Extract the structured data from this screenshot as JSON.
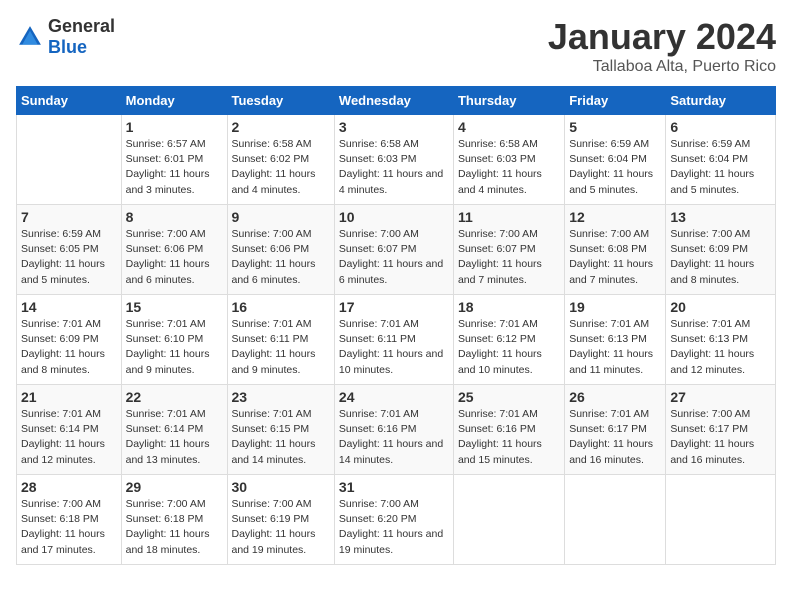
{
  "header": {
    "logo_general": "General",
    "logo_blue": "Blue",
    "month_title": "January 2024",
    "subtitle": "Tallaboa Alta, Puerto Rico"
  },
  "days_of_week": [
    "Sunday",
    "Monday",
    "Tuesday",
    "Wednesday",
    "Thursday",
    "Friday",
    "Saturday"
  ],
  "weeks": [
    [
      {
        "date": "",
        "sunrise": "",
        "sunset": "",
        "daylight": ""
      },
      {
        "date": "1",
        "sunrise": "Sunrise: 6:57 AM",
        "sunset": "Sunset: 6:01 PM",
        "daylight": "Daylight: 11 hours and 3 minutes."
      },
      {
        "date": "2",
        "sunrise": "Sunrise: 6:58 AM",
        "sunset": "Sunset: 6:02 PM",
        "daylight": "Daylight: 11 hours and 4 minutes."
      },
      {
        "date": "3",
        "sunrise": "Sunrise: 6:58 AM",
        "sunset": "Sunset: 6:03 PM",
        "daylight": "Daylight: 11 hours and 4 minutes."
      },
      {
        "date": "4",
        "sunrise": "Sunrise: 6:58 AM",
        "sunset": "Sunset: 6:03 PM",
        "daylight": "Daylight: 11 hours and 4 minutes."
      },
      {
        "date": "5",
        "sunrise": "Sunrise: 6:59 AM",
        "sunset": "Sunset: 6:04 PM",
        "daylight": "Daylight: 11 hours and 5 minutes."
      },
      {
        "date": "6",
        "sunrise": "Sunrise: 6:59 AM",
        "sunset": "Sunset: 6:04 PM",
        "daylight": "Daylight: 11 hours and 5 minutes."
      }
    ],
    [
      {
        "date": "7",
        "sunrise": "Sunrise: 6:59 AM",
        "sunset": "Sunset: 6:05 PM",
        "daylight": "Daylight: 11 hours and 5 minutes."
      },
      {
        "date": "8",
        "sunrise": "Sunrise: 7:00 AM",
        "sunset": "Sunset: 6:06 PM",
        "daylight": "Daylight: 11 hours and 6 minutes."
      },
      {
        "date": "9",
        "sunrise": "Sunrise: 7:00 AM",
        "sunset": "Sunset: 6:06 PM",
        "daylight": "Daylight: 11 hours and 6 minutes."
      },
      {
        "date": "10",
        "sunrise": "Sunrise: 7:00 AM",
        "sunset": "Sunset: 6:07 PM",
        "daylight": "Daylight: 11 hours and 6 minutes."
      },
      {
        "date": "11",
        "sunrise": "Sunrise: 7:00 AM",
        "sunset": "Sunset: 6:07 PM",
        "daylight": "Daylight: 11 hours and 7 minutes."
      },
      {
        "date": "12",
        "sunrise": "Sunrise: 7:00 AM",
        "sunset": "Sunset: 6:08 PM",
        "daylight": "Daylight: 11 hours and 7 minutes."
      },
      {
        "date": "13",
        "sunrise": "Sunrise: 7:00 AM",
        "sunset": "Sunset: 6:09 PM",
        "daylight": "Daylight: 11 hours and 8 minutes."
      }
    ],
    [
      {
        "date": "14",
        "sunrise": "Sunrise: 7:01 AM",
        "sunset": "Sunset: 6:09 PM",
        "daylight": "Daylight: 11 hours and 8 minutes."
      },
      {
        "date": "15",
        "sunrise": "Sunrise: 7:01 AM",
        "sunset": "Sunset: 6:10 PM",
        "daylight": "Daylight: 11 hours and 9 minutes."
      },
      {
        "date": "16",
        "sunrise": "Sunrise: 7:01 AM",
        "sunset": "Sunset: 6:11 PM",
        "daylight": "Daylight: 11 hours and 9 minutes."
      },
      {
        "date": "17",
        "sunrise": "Sunrise: 7:01 AM",
        "sunset": "Sunset: 6:11 PM",
        "daylight": "Daylight: 11 hours and 10 minutes."
      },
      {
        "date": "18",
        "sunrise": "Sunrise: 7:01 AM",
        "sunset": "Sunset: 6:12 PM",
        "daylight": "Daylight: 11 hours and 10 minutes."
      },
      {
        "date": "19",
        "sunrise": "Sunrise: 7:01 AM",
        "sunset": "Sunset: 6:13 PM",
        "daylight": "Daylight: 11 hours and 11 minutes."
      },
      {
        "date": "20",
        "sunrise": "Sunrise: 7:01 AM",
        "sunset": "Sunset: 6:13 PM",
        "daylight": "Daylight: 11 hours and 12 minutes."
      }
    ],
    [
      {
        "date": "21",
        "sunrise": "Sunrise: 7:01 AM",
        "sunset": "Sunset: 6:14 PM",
        "daylight": "Daylight: 11 hours and 12 minutes."
      },
      {
        "date": "22",
        "sunrise": "Sunrise: 7:01 AM",
        "sunset": "Sunset: 6:14 PM",
        "daylight": "Daylight: 11 hours and 13 minutes."
      },
      {
        "date": "23",
        "sunrise": "Sunrise: 7:01 AM",
        "sunset": "Sunset: 6:15 PM",
        "daylight": "Daylight: 11 hours and 14 minutes."
      },
      {
        "date": "24",
        "sunrise": "Sunrise: 7:01 AM",
        "sunset": "Sunset: 6:16 PM",
        "daylight": "Daylight: 11 hours and 14 minutes."
      },
      {
        "date": "25",
        "sunrise": "Sunrise: 7:01 AM",
        "sunset": "Sunset: 6:16 PM",
        "daylight": "Daylight: 11 hours and 15 minutes."
      },
      {
        "date": "26",
        "sunrise": "Sunrise: 7:01 AM",
        "sunset": "Sunset: 6:17 PM",
        "daylight": "Daylight: 11 hours and 16 minutes."
      },
      {
        "date": "27",
        "sunrise": "Sunrise: 7:00 AM",
        "sunset": "Sunset: 6:17 PM",
        "daylight": "Daylight: 11 hours and 16 minutes."
      }
    ],
    [
      {
        "date": "28",
        "sunrise": "Sunrise: 7:00 AM",
        "sunset": "Sunset: 6:18 PM",
        "daylight": "Daylight: 11 hours and 17 minutes."
      },
      {
        "date": "29",
        "sunrise": "Sunrise: 7:00 AM",
        "sunset": "Sunset: 6:18 PM",
        "daylight": "Daylight: 11 hours and 18 minutes."
      },
      {
        "date": "30",
        "sunrise": "Sunrise: 7:00 AM",
        "sunset": "Sunset: 6:19 PM",
        "daylight": "Daylight: 11 hours and 19 minutes."
      },
      {
        "date": "31",
        "sunrise": "Sunrise: 7:00 AM",
        "sunset": "Sunset: 6:20 PM",
        "daylight": "Daylight: 11 hours and 19 minutes."
      },
      {
        "date": "",
        "sunrise": "",
        "sunset": "",
        "daylight": ""
      },
      {
        "date": "",
        "sunrise": "",
        "sunset": "",
        "daylight": ""
      },
      {
        "date": "",
        "sunrise": "",
        "sunset": "",
        "daylight": ""
      }
    ]
  ]
}
